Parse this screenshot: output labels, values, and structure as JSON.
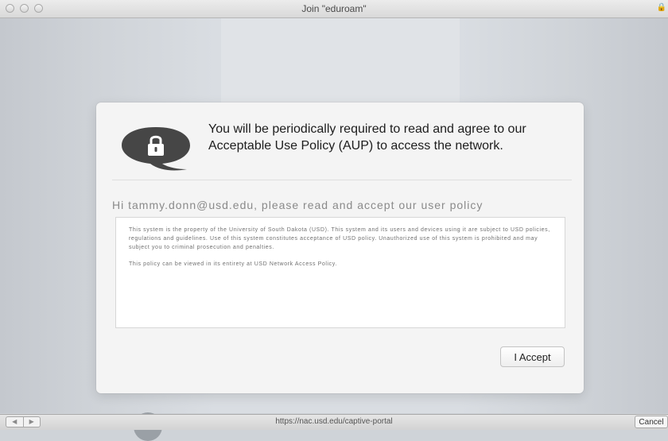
{
  "window": {
    "title": "Join \"eduroam\""
  },
  "dialog": {
    "headline": "You will be periodically required to read and agree to our Acceptable Use Policy (AUP) to access the network.",
    "greeting": "Hi tammy.donn@usd.edu, please read and accept our user policy",
    "policy_paragraphs": [
      "This system is the property of the University of South Dakota (USD). This system and its users and devices using it are subject to USD policies, regulations and guidelines. Use of this system constitutes acceptance of USD policy. Unauthorized use of this system is prohibited and may subject you to criminal prosecution and penalties.",
      "This policy can be viewed in its entirety at USD Network Access Policy."
    ],
    "accept_label": "I Accept"
  },
  "statusbar": {
    "url": "https://nac.usd.edu/captive-portal",
    "back_glyph": "◀",
    "forward_glyph": "▶",
    "cancel_label": "Cancel"
  },
  "icons": [
    "speech-bubble-lock-icon",
    "lock-icon"
  ]
}
